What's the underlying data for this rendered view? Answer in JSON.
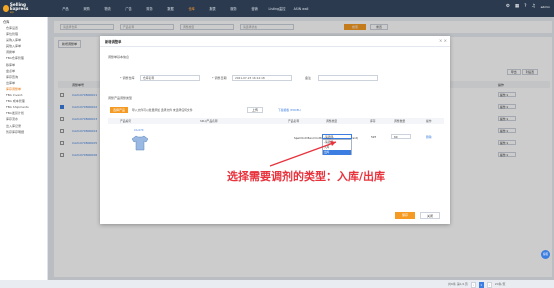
{
  "topbar": {
    "logo_title": "Selling Express",
    "logo_sub": "erp",
    "nav": [
      "产品",
      "采购",
      "物流",
      "广告",
      "财务",
      "数据",
      "仓库",
      "报表",
      "服务",
      "营销",
      "Listing监控",
      "ASIN wall"
    ],
    "active_nav_index": 6,
    "user": "admin"
  },
  "sidebar": {
    "group": "仓库",
    "items": [
      "仓库设置",
      "库位管理",
      "采购入库单",
      "其他入库单",
      "调拨单",
      "FBA仓库管理",
      "移库单",
      "盘点单",
      "库存查询",
      "出库单",
      "库存调整单",
      "FBA Invent.",
      "FBA 成本管理",
      "FBA Shipments",
      "FBA发货计划",
      "库存流水",
      "出入库记录",
      "暂存库存明细"
    ],
    "active_index": 10
  },
  "filterbar": {
    "f1": "请选择仓库",
    "f2": "产品名称",
    "f3": "调整类型",
    "f4": "请选择状态",
    "search": "搜索",
    "reset": "重置"
  },
  "panel": {
    "tab": "新增调整单",
    "right_btns": [
      "导出",
      "列设置"
    ],
    "head": [
      "调整单号",
      "操作"
    ],
    "rows": [
      {
        "no": "CA21070800001",
        "checked": false
      },
      {
        "no": "CA21070800002",
        "checked": true
      },
      {
        "no": "CA21070800003",
        "checked": false
      },
      {
        "no": "CA21070800004",
        "checked": false
      },
      {
        "no": "CA21070800005",
        "checked": false
      },
      {
        "no": "CA21070800006",
        "checked": false
      }
    ],
    "op": "操作 ▾"
  },
  "pager": {
    "total": "共6条 第1/1页",
    "page": "1",
    "per": "20条/页"
  },
  "modal": {
    "title": "新增调整单",
    "close": "× ×",
    "section1": "调整单基本信息",
    "label_wh": "* 调整仓库",
    "wh_value": "仓库名称",
    "label_date": "* 调整日期",
    "date_value": "2021-07-23 16:14:18",
    "label_note": "备注",
    "section2": "调整产品调整类型",
    "pick_btn": "选择产品",
    "import_text": "导入文件可以批量添加   选择文件   未选择任何文件",
    "upload_btn": "上传",
    "download": "下载模板 (EXCEL)",
    "th": [
      "产品编号",
      "SKU/产品名称",
      "产品名称",
      "调整类型",
      "库存",
      "调整数量",
      "操作"
    ],
    "sku": "CA-070",
    "pname": "Spell Knit Band Cotton Cover (TPU Transparent)",
    "type_value": "-请选择-",
    "options": [
      "-请选择-",
      "入库",
      "出库"
    ],
    "stock": "597",
    "qty": "60",
    "delete": "删除",
    "save": "保存",
    "cancel": "关闭"
  },
  "annotation": "选择需要调剂的类型：入库/出库",
  "help": "客服"
}
